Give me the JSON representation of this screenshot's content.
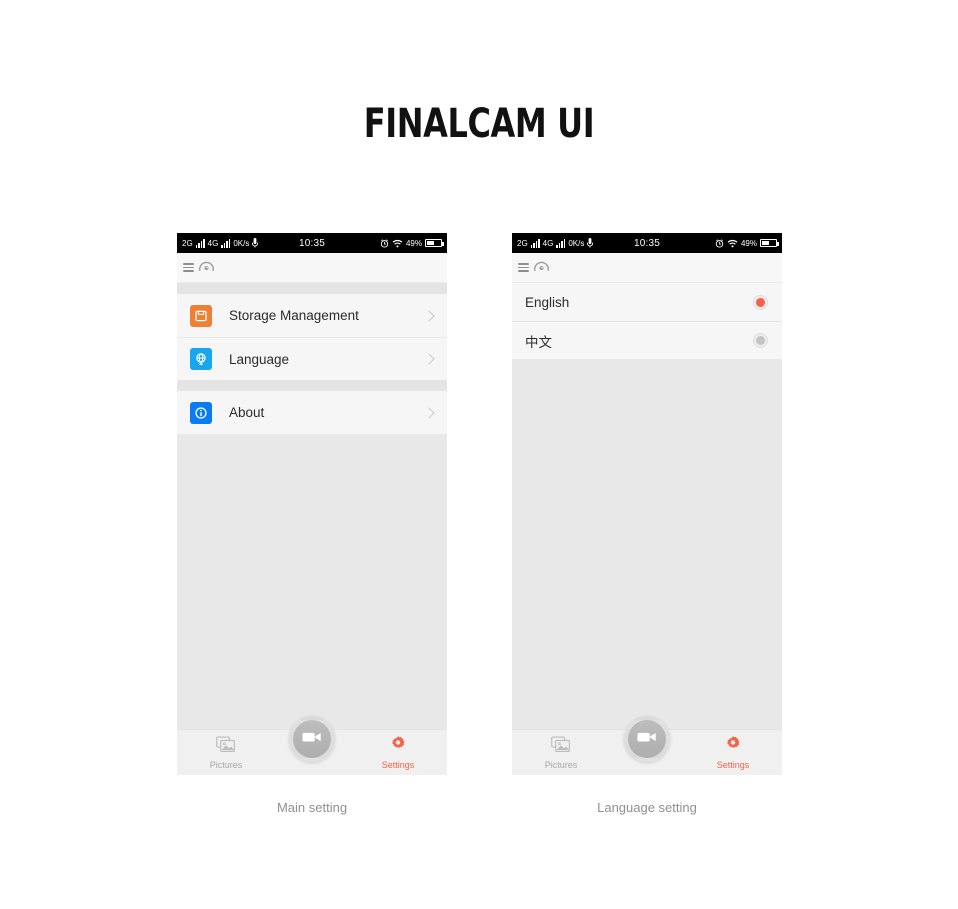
{
  "page": {
    "title": "FINALCAM UI",
    "accent_color": "#f4624a",
    "background": "#ffffff"
  },
  "statusbar": {
    "net_2g": "2G",
    "net_4g": "4G",
    "speed": "0K/s",
    "mic_icon": "microphone-icon",
    "time": "10:35",
    "alarm_icon": "alarm-icon",
    "wifi_icon": "wifi-icon",
    "battery_pct": "49%",
    "battery_icon": "battery-icon"
  },
  "appbar": {
    "menu_icon": "hamburger-menu-icon",
    "gauge_icon": "speedometer-icon"
  },
  "main_setting": {
    "caption": "Main setting",
    "rows": [
      {
        "label": "Storage Management",
        "icon": "storage-icon",
        "icon_color": "#ee8035",
        "chevron": "chevron-right-icon"
      },
      {
        "label": "Language",
        "icon": "globe-icon",
        "icon_color": "#18a7ef",
        "chevron": "chevron-right-icon"
      },
      {
        "label": "About",
        "icon": "info-icon",
        "icon_color": "#0a7cf0",
        "chevron": "chevron-right-icon"
      }
    ]
  },
  "language_setting": {
    "caption": "Language setting",
    "options": [
      {
        "label": "English",
        "selected": true
      },
      {
        "label": "中文",
        "selected": false
      }
    ]
  },
  "bottomnav": {
    "pictures_label": "Pictures",
    "pictures_icon": "gallery-icon",
    "capture_icon": "video-camera-icon",
    "settings_label": "Settings",
    "settings_icon": "gear-icon"
  }
}
